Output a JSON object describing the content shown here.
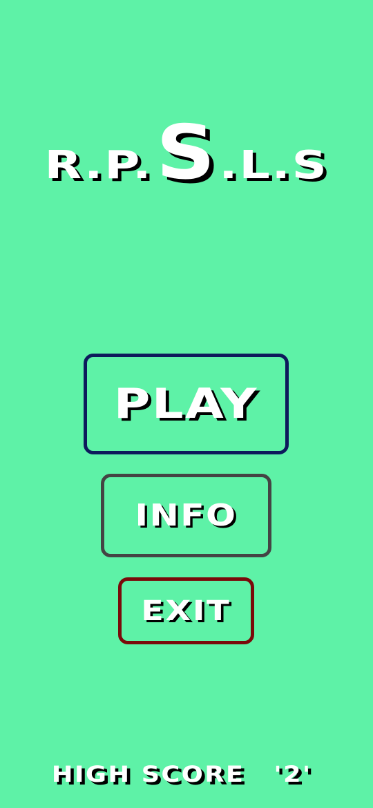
{
  "title": {
    "left": "R.P.",
    "big": "S",
    "right": ".L.S"
  },
  "menu": {
    "play_label": "PLAY",
    "info_label": "INFO",
    "exit_label": "EXIT"
  },
  "high_score": {
    "label": "HIGH SCORE",
    "value": "'2'"
  },
  "colors": {
    "background": "#5ef2a7",
    "play_border": "#0d1a5c",
    "info_border": "#444444",
    "exit_border": "#7a0a0a",
    "text": "#ffffff",
    "text_shadow": "#000000"
  }
}
